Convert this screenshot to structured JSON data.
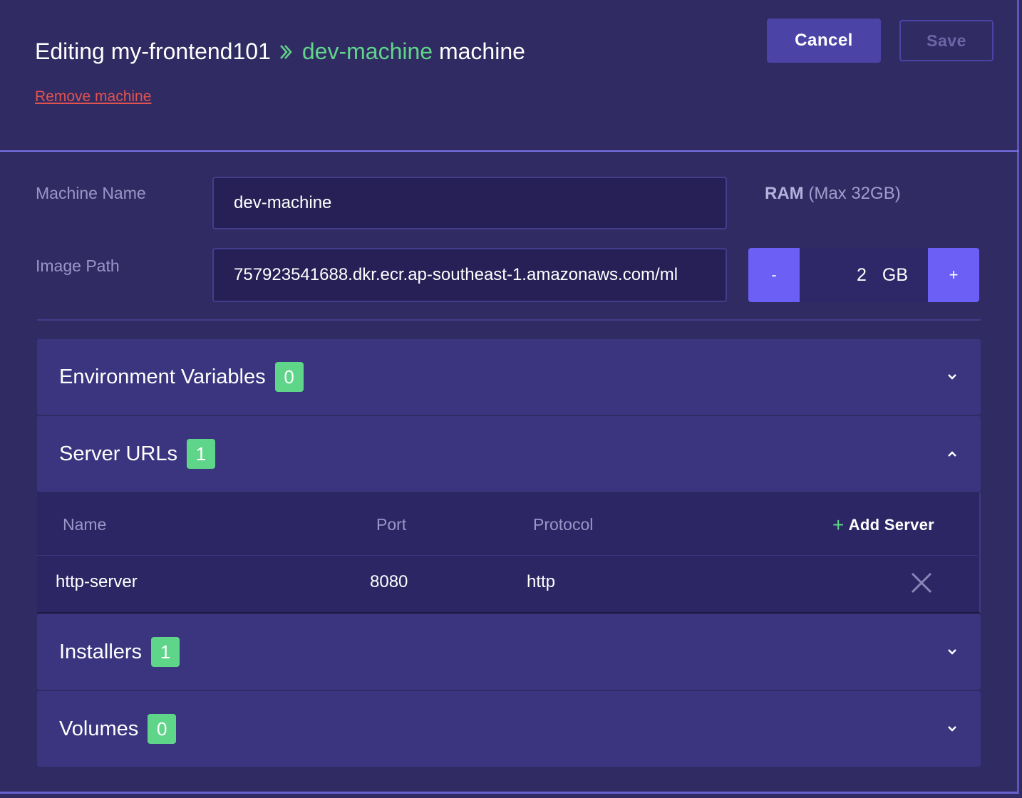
{
  "header": {
    "prefix": "Editing",
    "app_name": "my-frontend101",
    "machine_name": "dev-machine",
    "suffix": "machine",
    "remove_link": "Remove machine",
    "cancel_label": "Cancel",
    "save_label": "Save"
  },
  "form": {
    "machine_name_label": "Machine Name",
    "machine_name_value": "dev-machine",
    "image_path_label": "Image Path",
    "image_path_value": "757923541688.dkr.ecr.ap-southeast-1.amazonaws.com/ml",
    "ram_label": "RAM",
    "ram_hint": "(Max 32GB)",
    "ram_value": "2",
    "ram_unit": "GB",
    "ram_minus": "-",
    "ram_plus": "+"
  },
  "sections": {
    "env": {
      "title": "Environment Variables",
      "count": "0",
      "state": "collapsed"
    },
    "servers": {
      "title": "Server URLs",
      "count": "1",
      "state": "expanded"
    },
    "installers": {
      "title": "Installers",
      "count": "1",
      "state": "collapsed"
    },
    "volumes": {
      "title": "Volumes",
      "count": "0",
      "state": "collapsed"
    }
  },
  "servers_table": {
    "columns": [
      "Name",
      "Port",
      "Protocol"
    ],
    "add_label": "Add Server",
    "rows": [
      {
        "name": "http-server",
        "port": "8080",
        "protocol": "http"
      }
    ]
  },
  "colors": {
    "background": "#312b63",
    "accent": "#6c5ff5",
    "success": "#5fd58a",
    "danger": "#e2524f"
  }
}
